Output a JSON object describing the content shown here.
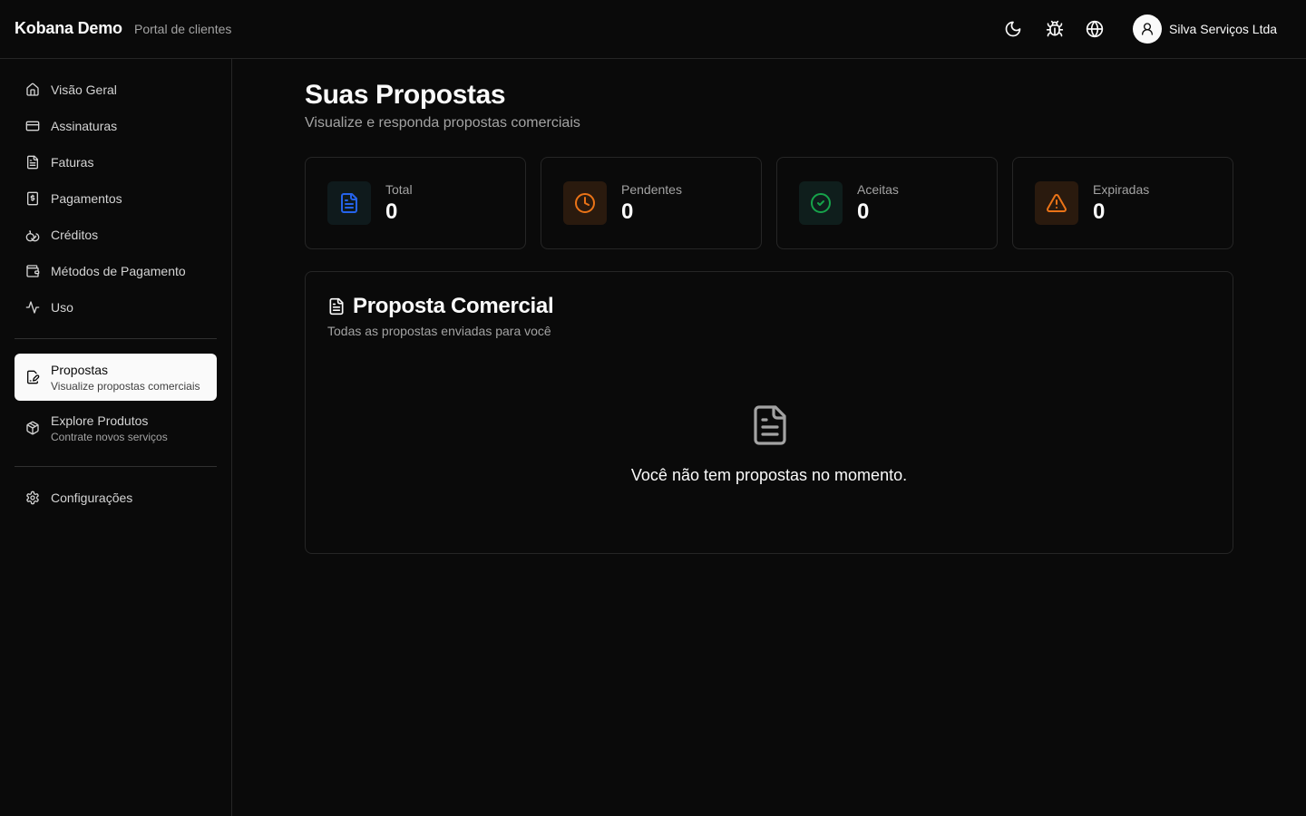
{
  "header": {
    "brand": "Kobana Demo",
    "subtitle": "Portal de clientes",
    "icons": [
      "moon-icon",
      "bug-icon",
      "globe-icon",
      "user-icon"
    ],
    "user_name": "Silva Serviços Ltda"
  },
  "sidebar": {
    "items": [
      {
        "label": "Visão Geral",
        "icon": "home-icon"
      },
      {
        "label": "Assinaturas",
        "icon": "credit-card-icon"
      },
      {
        "label": "Faturas",
        "icon": "file-text-icon"
      },
      {
        "label": "Pagamentos",
        "icon": "receipt-dollar-icon"
      },
      {
        "label": "Créditos",
        "icon": "coins-icon"
      },
      {
        "label": "Métodos de Pagamento",
        "icon": "wallet-icon"
      },
      {
        "label": "Uso",
        "icon": "activity-icon"
      }
    ],
    "featured": [
      {
        "label": "Propostas",
        "sub": "Visualize propostas comerciais",
        "icon": "file-signature-icon",
        "active": true
      },
      {
        "label": "Explore Produtos",
        "sub": "Contrate novos serviços",
        "icon": "package-icon",
        "active": false
      }
    ],
    "settings": {
      "label": "Configurações",
      "icon": "gear-icon"
    }
  },
  "main": {
    "title": "Suas Propostas",
    "subtitle": "Visualize e responda propostas comerciais",
    "stats": [
      {
        "label": "Total",
        "value": "0",
        "icon": "file-text-icon",
        "color": "#2563eb"
      },
      {
        "label": "Pendentes",
        "value": "0",
        "icon": "clock-icon",
        "color": "#ea7317"
      },
      {
        "label": "Aceitas",
        "value": "0",
        "icon": "check-circle-icon",
        "color": "#16a34a"
      },
      {
        "label": "Expiradas",
        "value": "0",
        "icon": "alert-triangle-icon",
        "color": "#ea7317"
      }
    ],
    "card": {
      "title": "Proposta Comercial",
      "subtitle": "Todas as propostas enviadas para você",
      "empty_text": "Você não tem propostas no momento."
    }
  }
}
